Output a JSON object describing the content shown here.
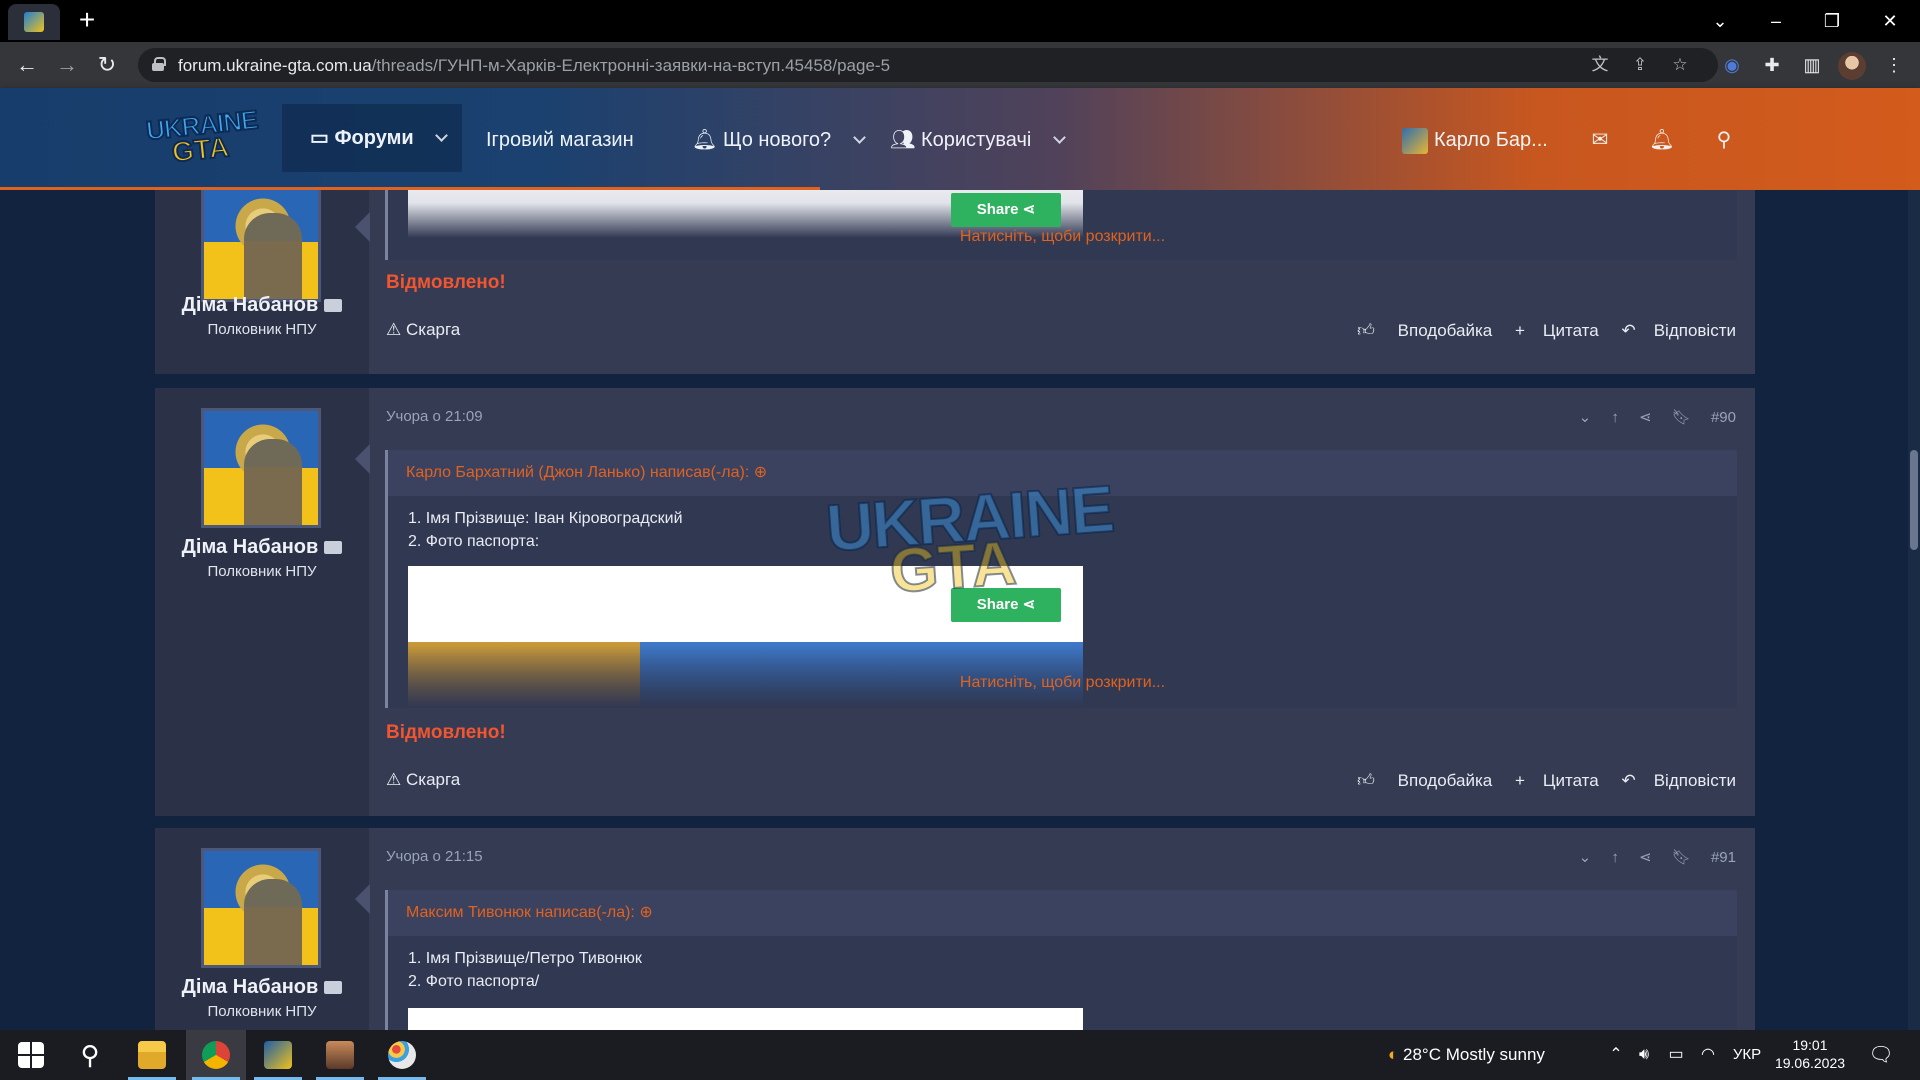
{
  "browser": {
    "url_host": "forum.ukraine-gta.com.ua",
    "url_path": "/threads/ГУНП-м-Харків-Електронні-заявки-на-вступ.45458/page-5"
  },
  "header": {
    "logo_line1": "UKRAINE",
    "logo_line2": "GTA",
    "nav": {
      "forums": "Форуми",
      "shop": "Ігровий магазин",
      "whats_new": "Що нового?",
      "members": "Користувачі"
    },
    "user_name": "Карло Бар..."
  },
  "posts": [
    {
      "author": "Діма Набанов",
      "author_title": "Полковник НПУ",
      "share_label": "Share",
      "expand_label": "Натисніть, щоби розкрити...",
      "verdict": "Відмовлено!",
      "report": "Скарга",
      "like": "Вподобайка",
      "quote": "Цитата",
      "reply": "Відповісти"
    },
    {
      "author": "Діма Набанов",
      "author_title": "Полковник НПУ",
      "date": "Учора о 21:09",
      "number": "#90",
      "quote_author": "Карло Бархатний (Джон Ланько) написав(-ла):",
      "quote_lines": [
        "1. Імя Прізвище: Іван Кіровоградский",
        "2. Фото паспорта:"
      ],
      "share_label": "Share",
      "expand_label": "Натисніть, щоби розкрити...",
      "verdict": "Відмовлено!",
      "report": "Скарга",
      "like": "Вподобайка",
      "quote": "Цитата",
      "reply": "Відповісти"
    },
    {
      "author": "Діма Набанов",
      "author_title": "Полковник НПУ",
      "date": "Учора о 21:15",
      "number": "#91",
      "quote_author": "Максим Тивонюк написав(-ла):",
      "quote_lines": [
        "1. Імя Прізвище/Петро Тивонюк",
        "2. Фото паспорта/"
      ]
    }
  ],
  "watermark": {
    "line1": "UKRAINE",
    "line2": "GTA"
  },
  "taskbar": {
    "weather": "28°C  Mostly sunny",
    "lang": "УКР",
    "time": "19:01",
    "date": "19.06.2023"
  }
}
